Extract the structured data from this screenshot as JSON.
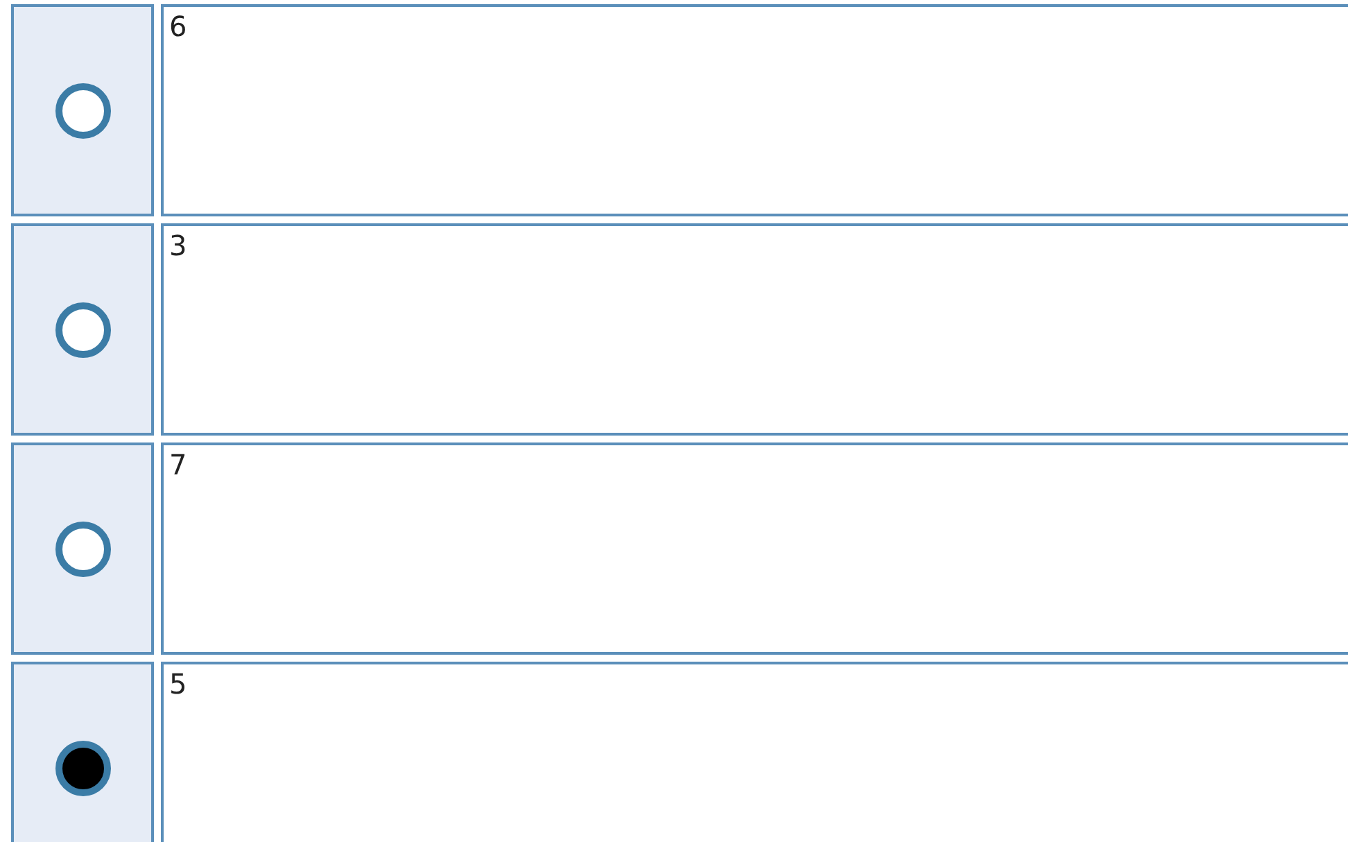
{
  "options": [
    {
      "label": "6",
      "selected": false
    },
    {
      "label": "3",
      "selected": false
    },
    {
      "label": "7",
      "selected": false
    },
    {
      "label": "5",
      "selected": true
    }
  ]
}
